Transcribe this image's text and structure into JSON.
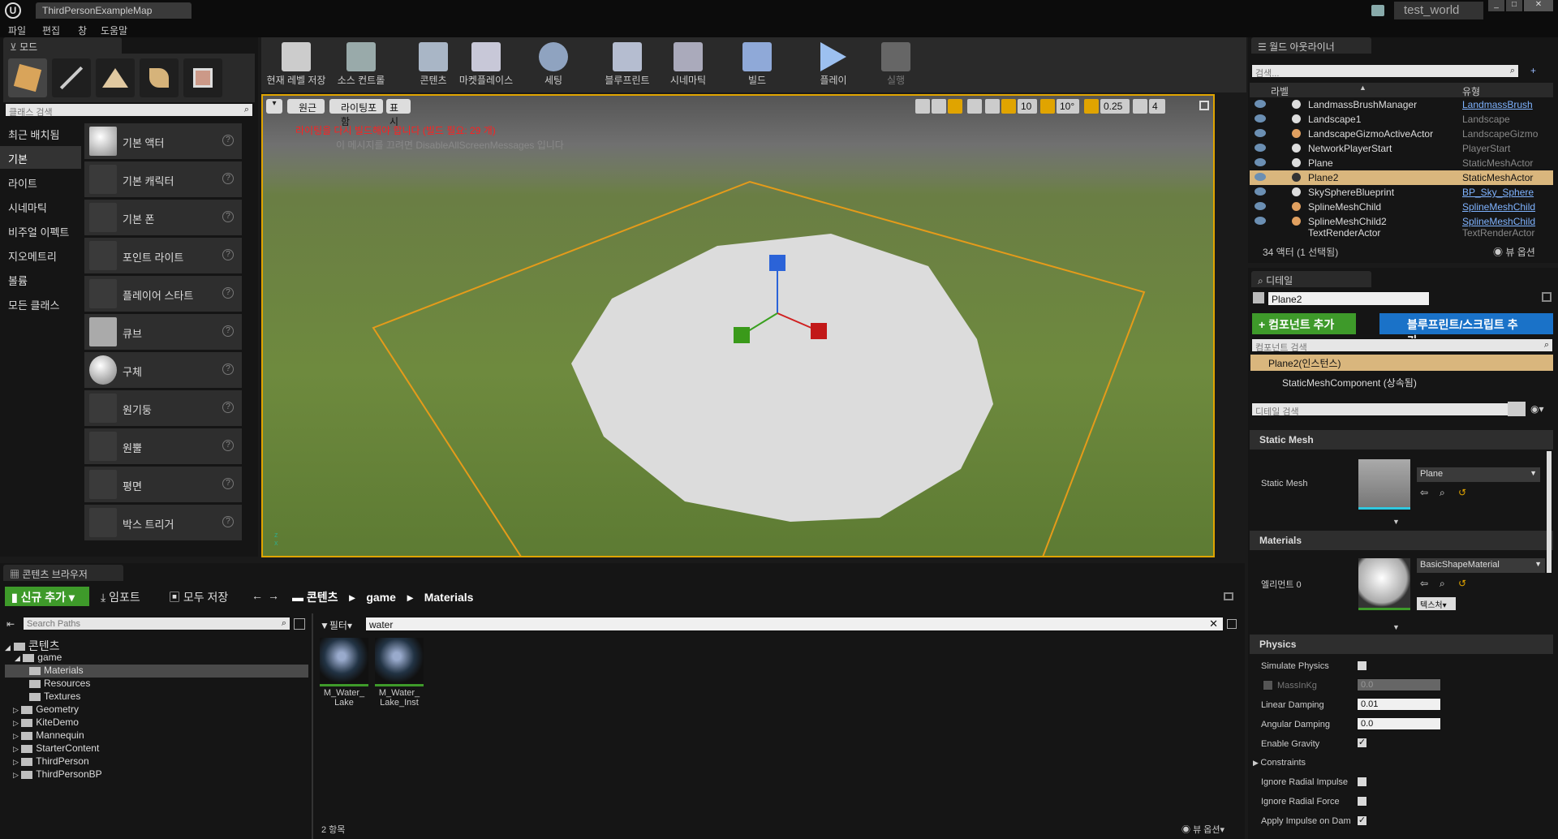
{
  "window": {
    "tab_title": "ThirdPersonExampleMap",
    "project": "test_world"
  },
  "menu": [
    "파일",
    "편집",
    "창",
    "도움말"
  ],
  "modes": {
    "tab": "모드",
    "search_placeholder": "클래스 검색",
    "categories": [
      "최근 배치됨",
      "기본",
      "라이트",
      "시네마틱",
      "비주얼 이펙트",
      "지오메트리",
      "볼륨",
      "모든 클래스"
    ],
    "items": [
      "기본 액터",
      "기본 캐릭터",
      "기본 폰",
      "포인트 라이트",
      "플레이어 스타트",
      "큐브",
      "구체",
      "원기둥",
      "원뿔",
      "평면",
      "박스 트리거"
    ]
  },
  "toolbar": [
    "현재 레벨 저장",
    "소스 컨트롤",
    "콘텐츠",
    "마켓플레이스",
    "세팅",
    "블루프린트",
    "시네마틱",
    "빌드",
    "플레이",
    "실행"
  ],
  "viewport": {
    "perspective": "원근",
    "lighting": "라이팅포함",
    "show": "표시",
    "warning": "라이팅을 다시 빌드해야 합니다 (빌드 필요: 29 개)",
    "hint": "이 메시지를 끄려면 DisableAllScreenMessages 입니다",
    "grid": "10",
    "angle": "10°",
    "scale": "0.25",
    "camspeed": "4"
  },
  "outliner": {
    "tab": "월드 아웃라이너",
    "search_placeholder": "검색...",
    "col_label": "라벨",
    "col_type": "유형",
    "rows": [
      {
        "name": "LandmassBrushManager",
        "type": "LandmassBrush",
        "link": true
      },
      {
        "name": "Landscape1",
        "type": "Landscape",
        "link": false
      },
      {
        "name": "LandscapeGizmoActiveActor",
        "type": "LandscapeGizmo",
        "link": false
      },
      {
        "name": "NetworkPlayerStart",
        "type": "PlayerStart",
        "link": false
      },
      {
        "name": "Plane",
        "type": "StaticMeshActor",
        "link": false
      },
      {
        "name": "Plane2",
        "type": "StaticMeshActor",
        "link": false
      },
      {
        "name": "SkySphereBlueprint",
        "type": "BP_Sky_Sphere",
        "link": true
      },
      {
        "name": "SplineMeshChild",
        "type": "SplineMeshChild",
        "link": true
      },
      {
        "name": "SplineMeshChild2",
        "type": "SplineMeshChild",
        "link": true
      },
      {
        "name": "TextRenderActor",
        "type": "TextRenderActor",
        "link": false
      }
    ],
    "count": "34 액터 (1 선택됨)",
    "view_options": "뷰 옵션"
  },
  "details": {
    "tab": "디테일",
    "name": "Plane2",
    "add_component": "+ 컴포넌트 추가",
    "add_blueprint": "블루프린트/스크립트 추가",
    "component_search": "컴포넌트 검색",
    "instance": "Plane2(인스턴스)",
    "component": "StaticMeshComponent (상속됨)",
    "detail_search": "디테일 검색",
    "sec_static_mesh": "Static Mesh",
    "static_mesh_label": "Static Mesh",
    "static_mesh_value": "Plane",
    "sec_materials": "Materials",
    "element0": "엘리먼트 0",
    "material_value": "BasicShapeMaterial",
    "texture_btn": "텍스처",
    "sec_physics": "Physics",
    "physics": {
      "simulate": "Simulate Physics",
      "mass": "MassInKg",
      "mass_val": "0.0",
      "linear": "Linear Damping",
      "linear_val": "0.01",
      "angular": "Angular Damping",
      "angular_val": "0.0",
      "gravity": "Enable Gravity",
      "constraints": "Constraints",
      "radial_impulse": "Ignore Radial Impulse",
      "radial_force": "Ignore Radial Force",
      "apply_impulse": "Apply Impulse on Dam"
    }
  },
  "content": {
    "tab": "콘텐츠 브라우저",
    "add_new": "신규 추가",
    "import": "임포트",
    "save_all": "모두 저장",
    "path": [
      "콘텐츠",
      "game",
      "Materials"
    ],
    "search_paths": "Search Paths",
    "filter": "필터",
    "filter_text": "water",
    "tree": [
      "콘텐츠",
      "game",
      "Materials",
      "Resources",
      "Textures",
      "Geometry",
      "KiteDemo",
      "Mannequin",
      "StarterContent",
      "ThirdPerson",
      "ThirdPersonBP"
    ],
    "assets": [
      {
        "l1": "M_Water_",
        "l2": "Lake"
      },
      {
        "l1": "M_Water_",
        "l2": "Lake_Inst"
      }
    ],
    "count": "2 항목",
    "view_options": "뷰 옵션"
  }
}
